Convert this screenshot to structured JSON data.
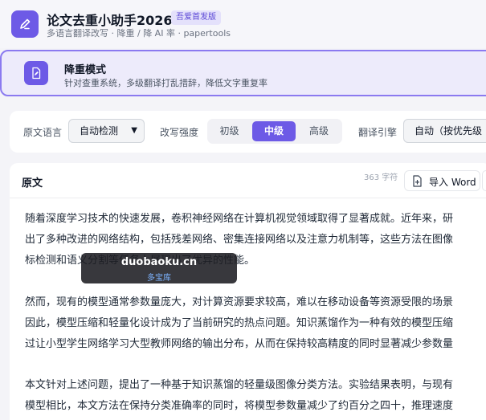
{
  "app": {
    "title": "论文去重小助手2026",
    "badge": "吾爱首发版",
    "subtitle": "多语言翻译改写 · 降重 / 降 AI 率 · papertools"
  },
  "mode": {
    "title": "降重模式",
    "description": "针对查重系统，多级翻译打乱措辞，降低文字重复率"
  },
  "options": {
    "source_language_label": "原文语言",
    "source_language_value": "自动检测",
    "strength_label": "改写强度",
    "strength_levels": [
      "初级",
      "中级",
      "高级"
    ],
    "strength_selected": "中级",
    "engine_label": "翻译引擎",
    "engine_value": "自动（按优先级"
  },
  "editor": {
    "title": "原文",
    "char_count": "363 字符",
    "import_label": "导入 Word",
    "paragraphs": [
      [
        "随着深度学习技术的快速发展，卷积神经网络在计算机视觉领域取得了显著成就。近年来，研",
        "出了多种改进的网络结构，包括残差网络、密集连接网络以及注意力机制等，这些方法在图像",
        "标检测和语义分割等任务上展现出了优异的性能。"
      ],
      [
        "然而，现有的模型通常参数量庞大，对计算资源要求较高，难以在移动设备等资源受限的场景",
        "因此，模型压缩和轻量化设计成为了当前研究的热点问题。知识蒸馏作为一种有效的模型压缩",
        "过让小型学生网络学习大型教师网络的输出分布，从而在保持较高精度的同时显著减少参数量"
      ],
      [
        "本文针对上述问题，提出了一种基于知识蒸馏的轻量级图像分类方法。实验结果表明，与现有",
        "模型相比，本文方法在保持分类准确率的同时，将模型参数量减少了约百分之四十，推理速度"
      ]
    ]
  },
  "watermark": {
    "title": "duobaoku.cn",
    "subtitle": "多宝库"
  },
  "colors": {
    "accent": "#6d5ae6",
    "accent_light": "#edebfb",
    "badge_bg": "#e4e1fb"
  }
}
